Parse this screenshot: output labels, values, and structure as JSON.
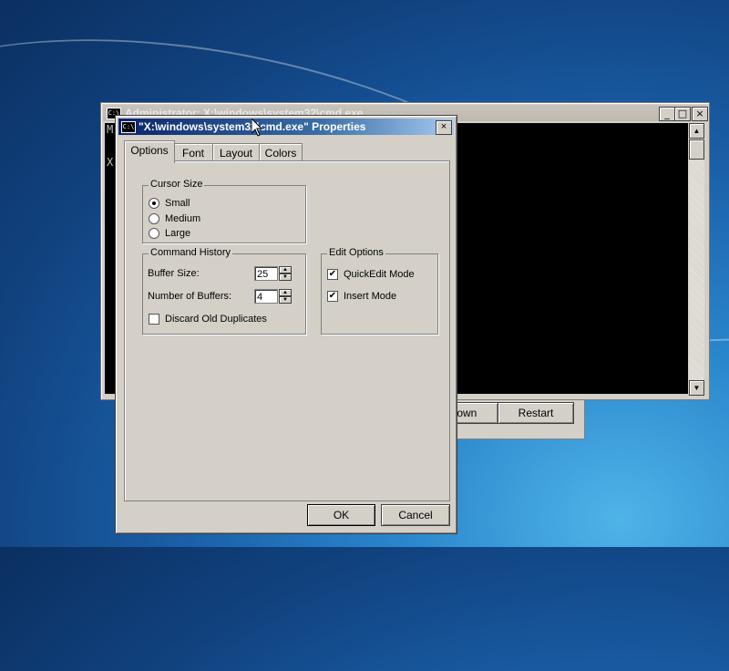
{
  "background_dialog": {
    "shutdown_label": "Shut Down",
    "restart_label": "Restart"
  },
  "cmd_window": {
    "icon_text": "C:\\",
    "title": "Administrator: X:\\windows\\system32\\cmd.exe",
    "minimize": "_",
    "maximize": "□",
    "close": "×",
    "console_lines": [
      "M",
      "X"
    ],
    "scroll_up": "▲",
    "scroll_down": "▼"
  },
  "properties_dialog": {
    "icon_text": "C:\\",
    "title": "\"X:\\windows\\system32\\cmd.exe\" Properties",
    "close": "×",
    "tabs": [
      {
        "label": "Options",
        "active": true
      },
      {
        "label": "Font",
        "active": false
      },
      {
        "label": "Layout",
        "active": false
      },
      {
        "label": "Colors",
        "active": false
      }
    ],
    "cursor_size": {
      "label": "Cursor Size",
      "options": [
        {
          "label": "Small",
          "selected": true
        },
        {
          "label": "Medium",
          "selected": false
        },
        {
          "label": "Large",
          "selected": false
        }
      ]
    },
    "command_history": {
      "label": "Command History",
      "buffer_size_label": "Buffer Size:",
      "buffer_size_value": "25",
      "num_buffers_label": "Number of Buffers:",
      "num_buffers_value": "4",
      "discard_label": "Discard Old Duplicates",
      "discard_checked": false
    },
    "edit_options": {
      "label": "Edit Options",
      "quickedit_label": "QuickEdit Mode",
      "quickedit_checked": true,
      "insert_label": "Insert Mode",
      "insert_checked": true,
      "check_glyph": "✔"
    },
    "spin_up": "▲",
    "spin_down": "▼",
    "ok_label": "OK",
    "cancel_label": "Cancel"
  },
  "colors": {
    "title_active_start": "#0a246a",
    "title_active_end": "#a6caf0",
    "dialog_face": "#d4d0c8",
    "console_bg": "#000000"
  }
}
